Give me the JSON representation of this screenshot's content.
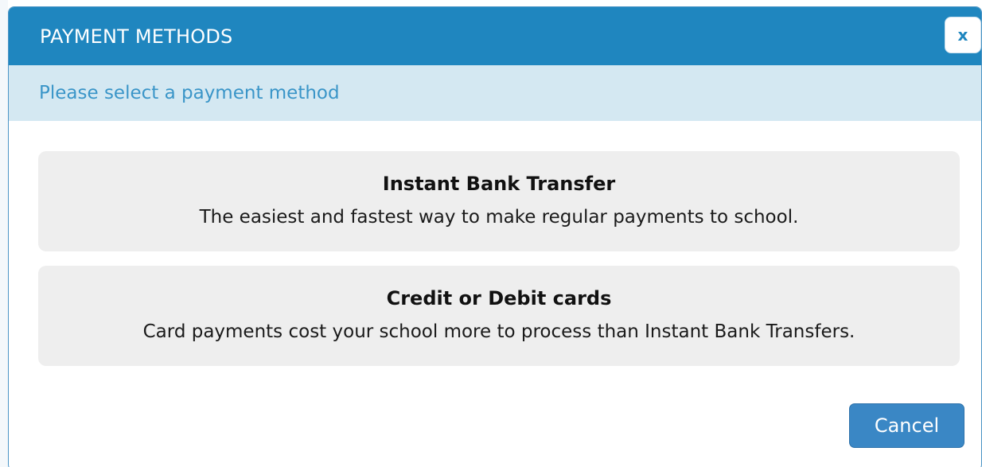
{
  "dialog": {
    "title": "PAYMENT METHODS",
    "subtitle": "Please select a payment method",
    "close_icon": "close-icon",
    "close_glyph": "x",
    "colors": {
      "header": "#1f86bf",
      "subheader": "#d4e8f2",
      "subheader_text": "#3a95c8",
      "option_bg": "#eeeeee",
      "cancel_button": "#3a87c5"
    }
  },
  "methods": [
    {
      "title": "Instant Bank Transfer",
      "description": "The easiest and fastest way to make regular payments to school."
    },
    {
      "title": "Credit or Debit cards",
      "description": "Card payments cost your school more to process than Instant Bank Transfers."
    }
  ],
  "actions": {
    "cancel_label": "Cancel"
  }
}
